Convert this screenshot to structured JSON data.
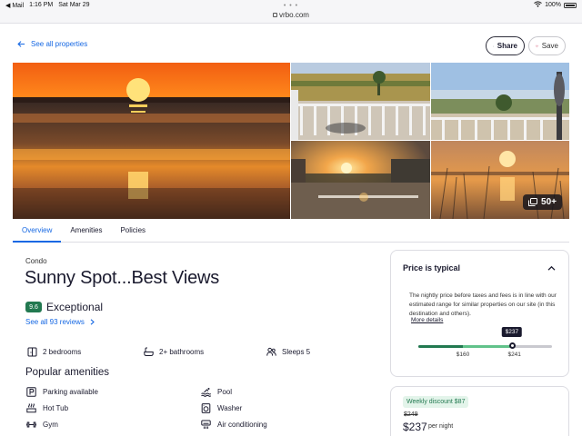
{
  "status": {
    "app": "Mail",
    "time": "1:16 PM",
    "date": "Sat Mar 29",
    "battery": "100%",
    "battery_level": 1.0
  },
  "browser": {
    "domain": "vrbo.com"
  },
  "nav": {
    "back_label": "See all properties",
    "share_label": "Share",
    "save_label": "Save"
  },
  "gallery": {
    "more_count": "50+"
  },
  "tabs": [
    "Overview",
    "Amenities",
    "Policies"
  ],
  "property": {
    "type": "Condo",
    "name": "Sunny Spot...Best Views",
    "score": "9.6",
    "score_label": "Exceptional",
    "reviews_link": "See all 93 reviews",
    "bedrooms": "2 bedrooms",
    "bathrooms": "2+ bathrooms",
    "sleeps": "Sleeps 5"
  },
  "amenities": {
    "heading": "Popular amenities",
    "items": [
      {
        "label": "Parking available",
        "icon": "parking-icon"
      },
      {
        "label": "Pool",
        "icon": "pool-icon"
      },
      {
        "label": "Hot Tub",
        "icon": "hot-tub-icon"
      },
      {
        "label": "Washer",
        "icon": "washer-icon"
      },
      {
        "label": "Gym",
        "icon": "gym-icon"
      },
      {
        "label": "Air conditioning",
        "icon": "air-conditioning-icon"
      }
    ]
  },
  "price_card": {
    "heading": "Price is typical",
    "description": "The nightly price before taxes and fees is in line with our estimated range for similar properties on our site (in this destination and others).",
    "more_link": "More details",
    "current_price": "$237",
    "range_low": "$160",
    "range_high": "$241",
    "range_min_value": 90,
    "range_max_value": 300,
    "low_value": 160,
    "high_value": 241,
    "current_value": 237
  },
  "booking": {
    "discount_badge": "Weekly discount $87",
    "original_price": "$249",
    "price": "$237",
    "per_night": "per night"
  },
  "colors": {
    "link_blue": "#1668e3",
    "rating_green": "#227950",
    "range_green": "#61c28a"
  }
}
